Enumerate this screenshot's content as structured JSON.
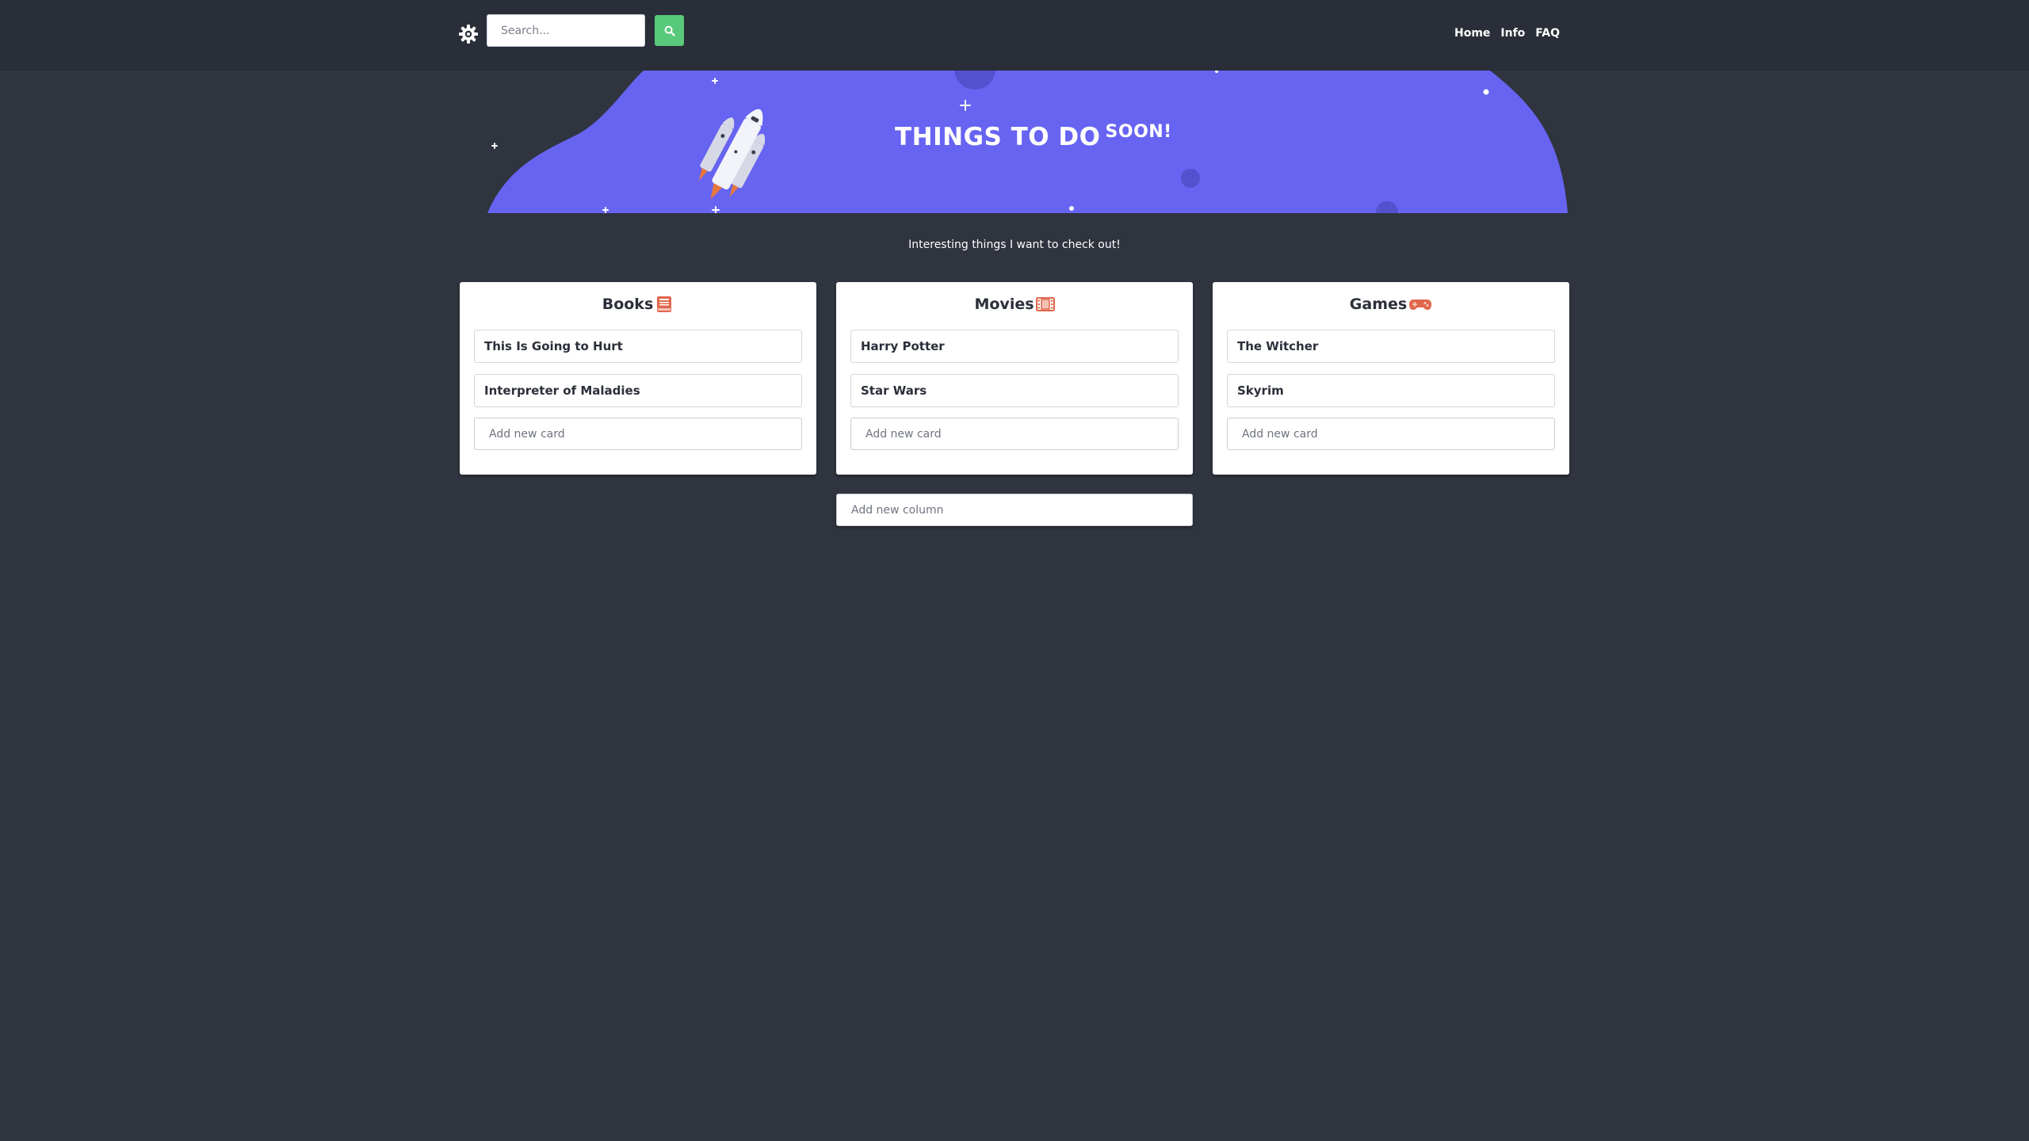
{
  "header": {
    "search_placeholder": "Search...",
    "nav": [
      {
        "label": "Home"
      },
      {
        "label": "Info"
      },
      {
        "label": "FAQ"
      }
    ]
  },
  "hero": {
    "title": "THINGS TO DO",
    "title_sup": "SOON!",
    "subtitle": "Interesting things I want to check out!"
  },
  "columns": [
    {
      "title": "Books",
      "icon": "book-icon",
      "cards": [
        "This Is Going to Hurt",
        "Interpreter of Maladies"
      ],
      "add_placeholder": "Add new card"
    },
    {
      "title": "Movies",
      "icon": "film-icon",
      "cards": [
        "Harry Potter",
        "Star Wars"
      ],
      "add_placeholder": "Add new card"
    },
    {
      "title": "Games",
      "icon": "gamepad-icon",
      "cards": [
        "The Witcher",
        "Skyrim"
      ],
      "add_placeholder": "Add new card"
    }
  ],
  "add_column_placeholder": "Add new column",
  "colors": {
    "background": "#30343f",
    "topbar": "#2a2e39",
    "hero": "#6764f2",
    "search_button": "#58c97a",
    "icon_accent": "#e0674c"
  }
}
